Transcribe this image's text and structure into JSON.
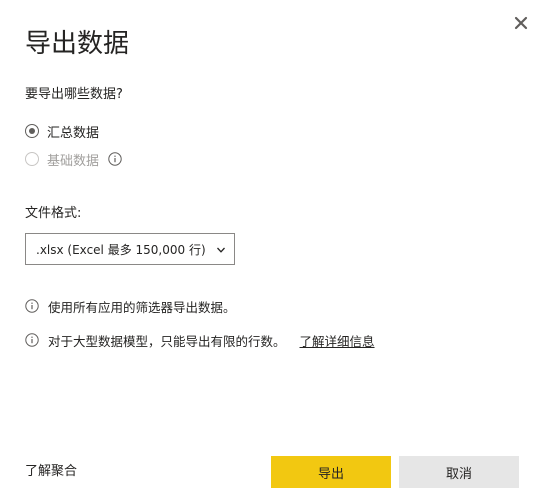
{
  "dialog": {
    "title": "导出数据",
    "question": "要导出哪些数据?",
    "options": [
      {
        "label": "汇总数据",
        "selected": true,
        "disabled": false
      },
      {
        "label": "基础数据",
        "selected": false,
        "disabled": true,
        "info_icon": "info-icon"
      }
    ],
    "file_format": {
      "label": "文件格式:",
      "selected": ".xlsx (Excel 最多 150,000 行)"
    },
    "notes": [
      {
        "icon": "info-icon",
        "text": "使用所有应用的筛选器导出数据。"
      },
      {
        "icon": "info-icon",
        "text": "对于大型数据模型，只能导出有限的行数。",
        "link": "了解详细信息"
      }
    ],
    "footer": {
      "learn_link": "了解聚合",
      "export_label": "导出",
      "cancel_label": "取消"
    },
    "close_icon": "close-icon"
  },
  "colors": {
    "primary_button": "#f2c811",
    "secondary_button": "#e6e6e6",
    "text": "#252423",
    "disabled_text": "#a19f9d"
  }
}
